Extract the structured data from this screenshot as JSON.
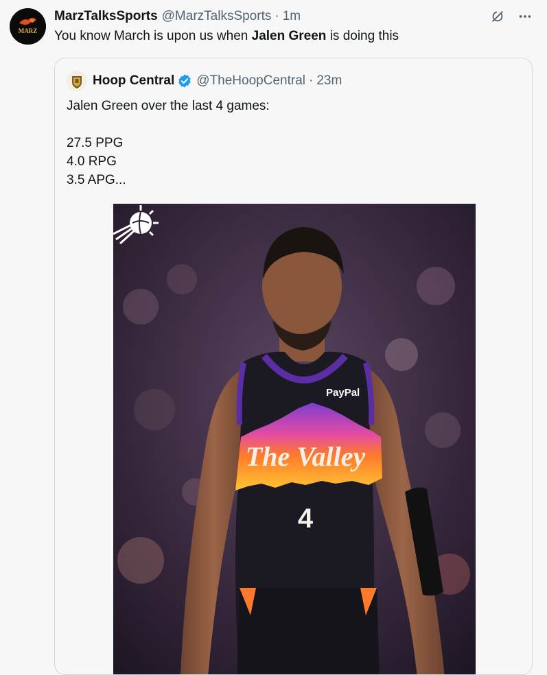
{
  "tweet": {
    "author_name": "MarzTalksSports",
    "author_handle": "@MarzTalksSports",
    "separator": "·",
    "time": "1m",
    "text_before": "You know March is upon us when ",
    "text_bold": "Jalen Green",
    "text_after": " is doing this",
    "avatar_text": "MARZ"
  },
  "quote": {
    "author_name": "Hoop Central",
    "author_handle": "@TheHoopCentral",
    "separator": "·",
    "time": "23m",
    "lines": [
      "Jalen Green over the last 4 games:",
      "",
      "27.5 PPG",
      "4.0 RPG",
      "3.5 APG..."
    ]
  },
  "media": {
    "jersey_wordmark": "The Valley",
    "jersey_number": "4",
    "sponsor": "PayPal"
  },
  "icons": {
    "grok": "grok-icon",
    "more": "more-icon",
    "verified": "verified-badge-icon",
    "team_logo": "suns-logo-icon"
  },
  "colors": {
    "background": "#f7f7f7",
    "text": "#0f1419",
    "secondary": "#536471",
    "verified": "#1d9bf0",
    "border": "#cfd9de"
  }
}
